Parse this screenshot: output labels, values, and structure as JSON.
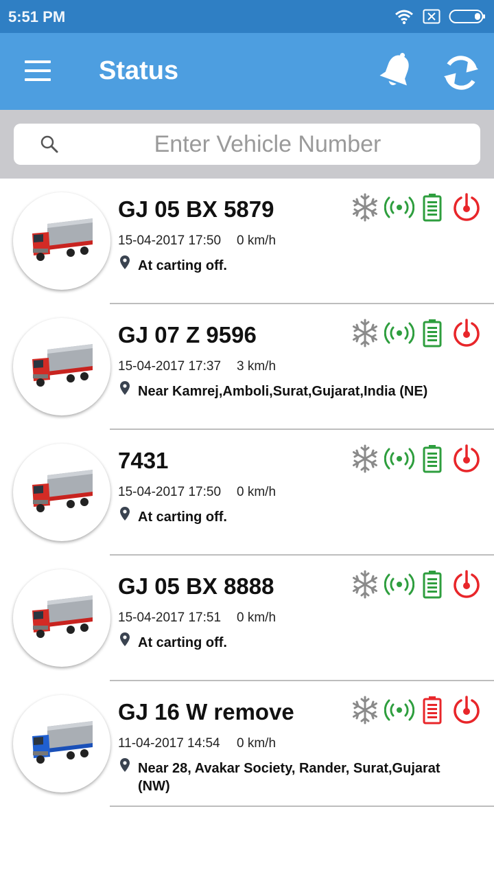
{
  "status_bar": {
    "time": "5:51 PM"
  },
  "app_bar": {
    "title": "Status"
  },
  "search": {
    "placeholder": "Enter Vehicle Number"
  },
  "colors": {
    "app_bar": "#4d9ee0",
    "status_bar": "#2f7fc4",
    "signal_green": "#2e9e3e",
    "power_red": "#e8262a",
    "snow_gray": "#8a8a8a"
  },
  "vehicles": [
    {
      "number": "GJ 05 BX 5879",
      "datetime": "15-04-2017 17:50",
      "speed": "0 km/h",
      "location": "At carting off.",
      "truck_color": "red",
      "battery": "green"
    },
    {
      "number": "GJ 07 Z 9596",
      "datetime": "15-04-2017 17:37",
      "speed": "3 km/h",
      "location": "Near Kamrej,Amboli,Surat,Gujarat,India (NE)",
      "truck_color": "red",
      "battery": "green"
    },
    {
      "number": "7431",
      "datetime": "15-04-2017 17:50",
      "speed": "0 km/h",
      "location": "At carting off.",
      "truck_color": "red",
      "battery": "green"
    },
    {
      "number": "GJ 05 BX 8888",
      "datetime": "15-04-2017 17:51",
      "speed": "0 km/h",
      "location": "At carting off.",
      "truck_color": "red",
      "battery": "green"
    },
    {
      "number": "GJ 16 W remove",
      "datetime": "11-04-2017 14:54",
      "speed": "0 km/h",
      "location": "Near 28, Avakar Society, Rander, Surat,Gujarat (NW)",
      "truck_color": "blue",
      "battery": "red"
    }
  ]
}
